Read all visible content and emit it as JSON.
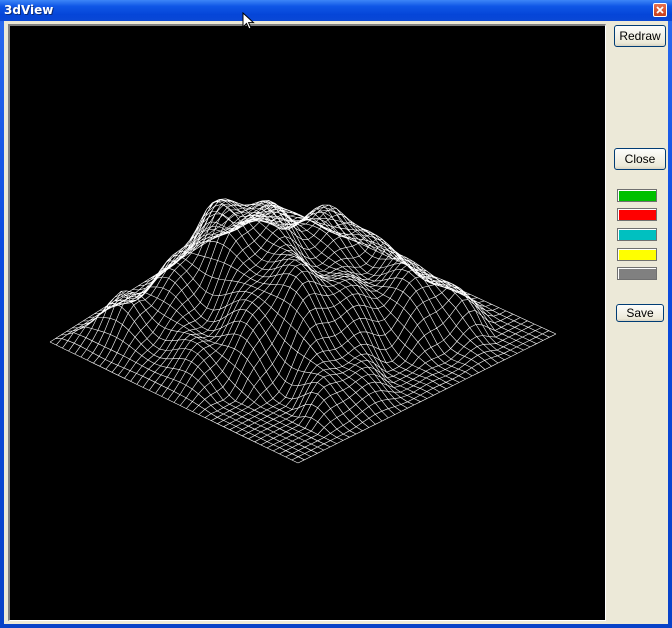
{
  "window": {
    "title": "3dView"
  },
  "buttons": {
    "redraw": "Redraw",
    "close": "Close",
    "save": "Save"
  },
  "colors": {
    "titlebar": "#0a48d6",
    "panel": "#ece9d8",
    "canvas": "#000000",
    "mesh": "#ffffff"
  },
  "swatches": [
    {
      "name": "green",
      "color": "#00c000"
    },
    {
      "name": "red",
      "color": "#ff0000"
    },
    {
      "name": "cyan",
      "color": "#00c0c0"
    },
    {
      "name": "yellow",
      "color": "#ffff00"
    },
    {
      "name": "gray",
      "color": "#808080"
    }
  ],
  "icons": {
    "close": "close-icon",
    "cursor": "mouse-pointer-icon"
  }
}
